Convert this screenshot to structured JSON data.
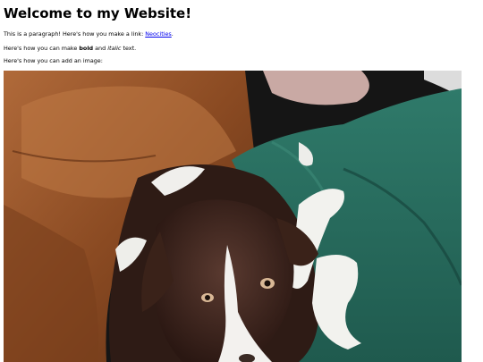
{
  "heading": "Welcome to my Website!",
  "paragraph1": {
    "text": "This is a paragraph! Here's how you make a link: ",
    "link_text": "Neocities",
    "suffix": "."
  },
  "paragraph2": {
    "prefix": "Here's how you can make ",
    "bold_text": "bold",
    "middle": " and ",
    "italic_text": "italic",
    "suffix": " text."
  },
  "paragraph3": {
    "text": "Here's how you can add an image:"
  },
  "colors": {
    "link": "#0000ee",
    "background": "#ffffff"
  }
}
